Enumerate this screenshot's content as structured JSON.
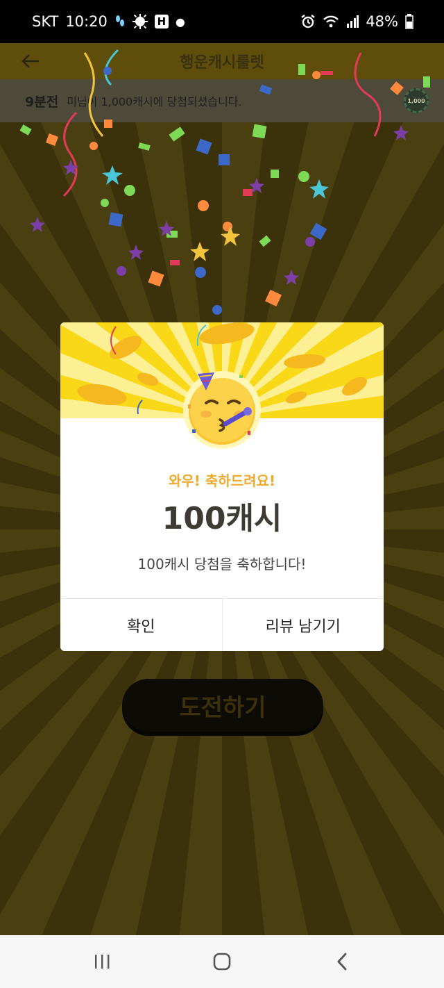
{
  "status_bar": {
    "carrier": "SKT",
    "time": "10:20",
    "battery": "48%",
    "icons": [
      "footprints-icon",
      "settings-icon",
      "h-icon",
      "dot-icon",
      "alarm-icon",
      "wifi-icon",
      "signal-icon",
      "battery-icon"
    ]
  },
  "header": {
    "title": "행운캐시룰렛",
    "back_icon": "arrow-left-icon"
  },
  "ticker": {
    "time": "9분전",
    "message": "미님이 1,000캐시에 당첨되셨습니다.",
    "badge": "1,000"
  },
  "modal": {
    "subtitle": "와우! 축하드려요!",
    "amount": "100캐시",
    "description": "100캐시 당첨을 축하합니다!",
    "confirm_label": "확인",
    "review_label": "리뷰 남기기",
    "emoji": "partying-face"
  },
  "challenge_button": {
    "label": "도전하기"
  },
  "nav": {
    "recents_icon": "recents-icon",
    "home_icon": "home-icon",
    "back_icon": "back-icon"
  },
  "colors": {
    "hero_yellow": "#f8d817",
    "subtitle_orange": "#f0a92a",
    "amount_text": "#3e3a34"
  }
}
